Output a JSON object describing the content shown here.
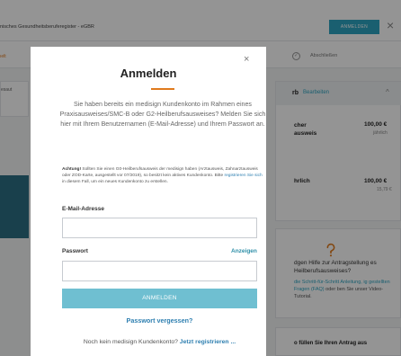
{
  "background": {
    "header": {
      "title": "nisches Gesundheitsberuferegister - eGBR",
      "login_button": "ANMELDEN",
      "close_glyph": "×"
    },
    "progress": {
      "step_left": "ıelt",
      "check_glyph": "✓",
      "step_abschliessen": "Abschließen"
    },
    "left_panel_text": "esaut",
    "card": {
      "title": "rb",
      "edit_link": "Bearbeiten",
      "chevron": "^",
      "item1_title_line1": "cher",
      "item1_title_line2": "ausweis",
      "item1_price": "100,00 €",
      "item1_sub": "jährlich",
      "item2_title": "hrlich",
      "item2_price": "100,00 €",
      "item2_sub": "15,79 €"
    },
    "help": {
      "icon": "question-bubble-icon",
      "title": "dgen Hilfe zur Antragstellung es Heilberufsausweises?",
      "text_a": "",
      "text_link": "die Schritt-für-Schritt Anleitung, ig gestellten Fragen (FAQ)",
      "text_b": " oder ben Sie unser Video-Tutorial."
    },
    "faq_bar_text": "o füllen Sie Ihren Antrag aus"
  },
  "modal": {
    "close_glyph": "×",
    "title": "Anmelden",
    "intro": "Sie haben bereits ein medisign Kundenkonto im Rahmen eines Praxisausweises/SMC-B oder G2-Heilberufsausweises? Melden Sie sich hier mit Ihrem Benutzernamen (E-Mail-Adresse) und Ihrem Passwort an.",
    "note_bold": "Achtung!",
    "note_text_a": " Sollten Sie einen G0-Heilberufsausweis der medisign haben (Arztausweis, Zahnarztausweis oder ZOD-Karte, ausgestellt vor 07/2019), so besitzt kein aktives Kundenkonto. Bitte ",
    "note_link": "registrieren Sie sich",
    "note_text_b": " in diesem Fall, um ein neues Kundenkonto zu erstellen.",
    "email_label": "E-Mail-Adresse",
    "email_value": "",
    "password_label": "Passwort",
    "password_show": "Anzeigen",
    "password_value": "",
    "submit_label": "ANMELDEN",
    "forgot_label": "Passwort vergessen?",
    "register_text": "Noch kein medisign Kundenkonto? ",
    "register_link": "Jetzt registrieren ..."
  },
  "colors": {
    "accent_orange": "#e07a1d",
    "primary_teal": "#2ea4c1",
    "submit_button": "#6fbfd1",
    "link_blue": "#2e7fb0"
  }
}
